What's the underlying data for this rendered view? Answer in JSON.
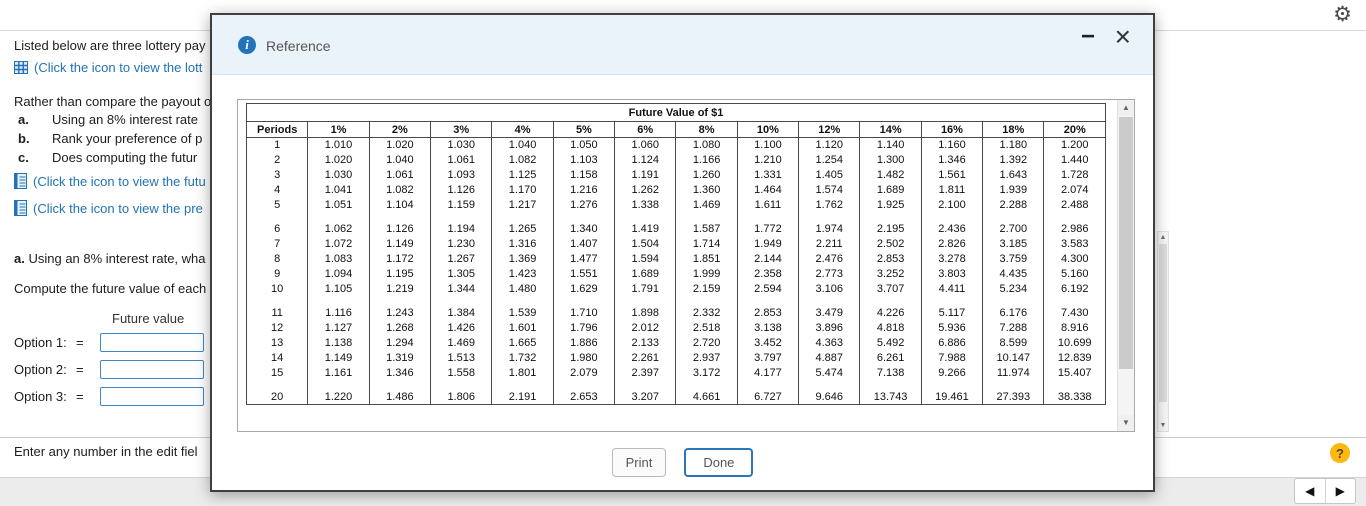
{
  "topbar": {
    "gear": "⚙"
  },
  "question": {
    "intro": "Listed below are three lottery pay",
    "lottery_link": "(Click the icon to view the lott",
    "rather_line": "Rather than compare the payout o",
    "parts": [
      {
        "label": "a.",
        "text": "Using an 8% interest rate"
      },
      {
        "label": "b.",
        "text": "Rank your preference of p"
      },
      {
        "label": "c.",
        "text": "Does computing the futur"
      }
    ],
    "future_table_link": "(Click the icon to view the futu",
    "present_table_link": "(Click the icon to view the pre",
    "section_a_label": "a.",
    "section_a_text": "Using an 8% interest rate, wha",
    "compute_line": "Compute the future value of each",
    "future_value_header": "Future value",
    "options": [
      {
        "label": "Option 1:",
        "equals": "=",
        "value": ""
      },
      {
        "label": "Option 2:",
        "equals": "=",
        "value": ""
      },
      {
        "label": "Option 3:",
        "equals": "=",
        "value": ""
      }
    ],
    "footer_hint": "Enter any number in the edit fiel"
  },
  "modal": {
    "title": "Reference",
    "info_glyph": "i",
    "minimize_glyph": "−",
    "close_glyph": "×",
    "print_label": "Print",
    "done_label": "Done"
  },
  "help_glyph": "?",
  "nav": {
    "prev_glyph": "◀",
    "next_glyph": "▶"
  },
  "scroll": {
    "up_glyph": "▲",
    "down_glyph": "▼"
  },
  "chart_data": {
    "type": "table",
    "title": "Future Value of $1",
    "columns": [
      "Periods",
      "1%",
      "2%",
      "3%",
      "4%",
      "5%",
      "6%",
      "8%",
      "10%",
      "12%",
      "14%",
      "16%",
      "18%",
      "20%"
    ],
    "row_groups": [
      [
        [
          "1",
          "1.010",
          "1.020",
          "1.030",
          "1.040",
          "1.050",
          "1.060",
          "1.080",
          "1.100",
          "1.120",
          "1.140",
          "1.160",
          "1.180",
          "1.200"
        ],
        [
          "2",
          "1.020",
          "1.040",
          "1.061",
          "1.082",
          "1.103",
          "1.124",
          "1.166",
          "1.210",
          "1.254",
          "1.300",
          "1.346",
          "1.392",
          "1.440"
        ],
        [
          "3",
          "1.030",
          "1.061",
          "1.093",
          "1.125",
          "1.158",
          "1.191",
          "1.260",
          "1.331",
          "1.405",
          "1.482",
          "1.561",
          "1.643",
          "1.728"
        ],
        [
          "4",
          "1.041",
          "1.082",
          "1.126",
          "1.170",
          "1.216",
          "1.262",
          "1.360",
          "1.464",
          "1.574",
          "1.689",
          "1.811",
          "1.939",
          "2.074"
        ],
        [
          "5",
          "1.051",
          "1.104",
          "1.159",
          "1.217",
          "1.276",
          "1.338",
          "1.469",
          "1.611",
          "1.762",
          "1.925",
          "2.100",
          "2.288",
          "2.488"
        ]
      ],
      [
        [
          "6",
          "1.062",
          "1.126",
          "1.194",
          "1.265",
          "1.340",
          "1.419",
          "1.587",
          "1.772",
          "1.974",
          "2.195",
          "2.436",
          "2.700",
          "2.986"
        ],
        [
          "7",
          "1.072",
          "1.149",
          "1.230",
          "1.316",
          "1.407",
          "1.504",
          "1.714",
          "1.949",
          "2.211",
          "2.502",
          "2.826",
          "3.185",
          "3.583"
        ],
        [
          "8",
          "1.083",
          "1.172",
          "1.267",
          "1.369",
          "1.477",
          "1.594",
          "1.851",
          "2.144",
          "2.476",
          "2.853",
          "3.278",
          "3.759",
          "4.300"
        ],
        [
          "9",
          "1.094",
          "1.195",
          "1.305",
          "1.423",
          "1.551",
          "1.689",
          "1.999",
          "2.358",
          "2.773",
          "3.252",
          "3.803",
          "4.435",
          "5.160"
        ],
        [
          "10",
          "1.105",
          "1.219",
          "1.344",
          "1.480",
          "1.629",
          "1.791",
          "2.159",
          "2.594",
          "3.106",
          "3.707",
          "4.411",
          "5.234",
          "6.192"
        ]
      ],
      [
        [
          "11",
          "1.116",
          "1.243",
          "1.384",
          "1.539",
          "1.710",
          "1.898",
          "2.332",
          "2.853",
          "3.479",
          "4.226",
          "5.117",
          "6.176",
          "7.430"
        ],
        [
          "12",
          "1.127",
          "1.268",
          "1.426",
          "1.601",
          "1.796",
          "2.012",
          "2.518",
          "3.138",
          "3.896",
          "4.818",
          "5.936",
          "7.288",
          "8.916"
        ],
        [
          "13",
          "1.138",
          "1.294",
          "1.469",
          "1.665",
          "1.886",
          "2.133",
          "2.720",
          "3.452",
          "4.363",
          "5.492",
          "6.886",
          "8.599",
          "10.699"
        ],
        [
          "14",
          "1.149",
          "1.319",
          "1.513",
          "1.732",
          "1.980",
          "2.261",
          "2.937",
          "3.797",
          "4.887",
          "6.261",
          "7.988",
          "10.147",
          "12.839"
        ],
        [
          "15",
          "1.161",
          "1.346",
          "1.558",
          "1.801",
          "2.079",
          "2.397",
          "3.172",
          "4.177",
          "5.474",
          "7.138",
          "9.266",
          "11.974",
          "15.407"
        ]
      ],
      [
        [
          "20",
          "1.220",
          "1.486",
          "1.806",
          "2.191",
          "2.653",
          "3.207",
          "4.661",
          "6.727",
          "9.646",
          "13.743",
          "19.461",
          "27.393",
          "38.338"
        ]
      ]
    ]
  }
}
